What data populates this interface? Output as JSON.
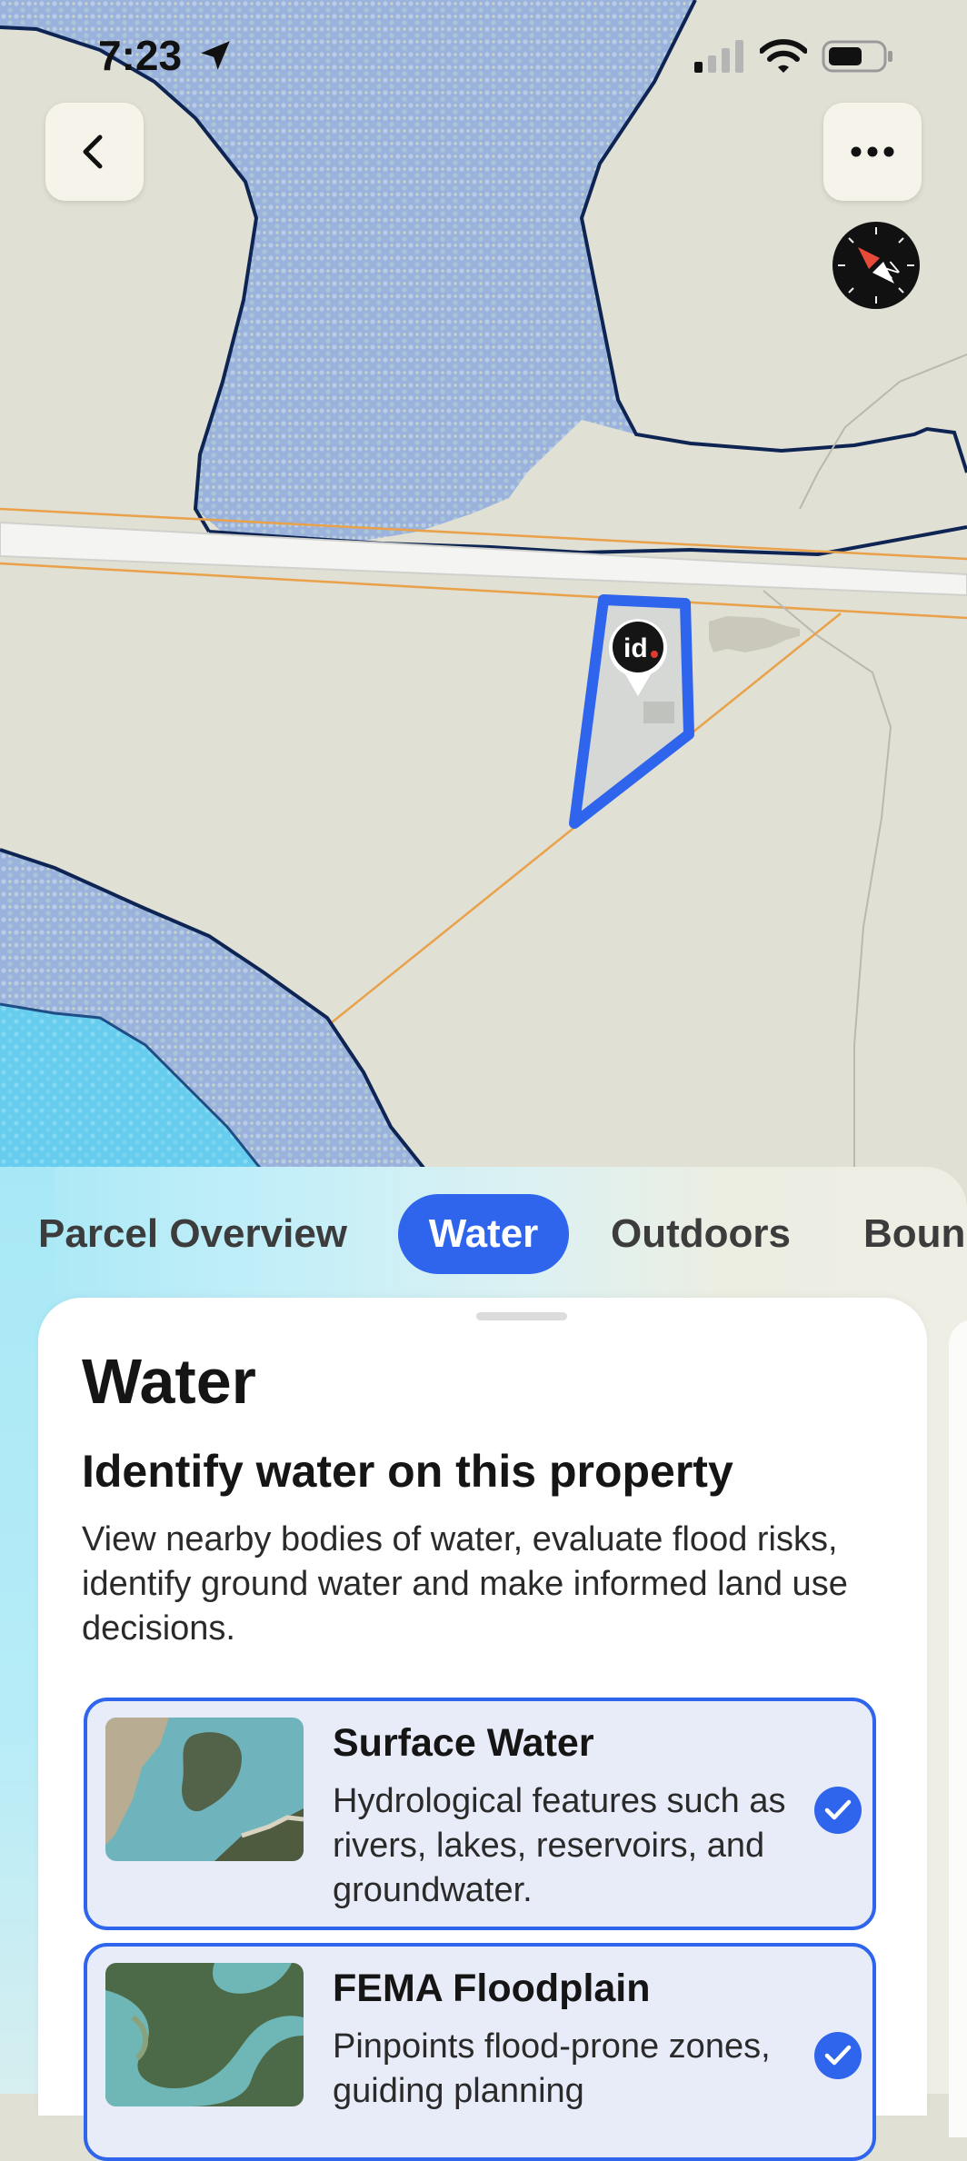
{
  "status_bar": {
    "time": "7:23",
    "location_icon": "location-arrow-icon",
    "signal_icon": "cellular-signal-icon",
    "wifi_icon": "wifi-icon",
    "battery_icon": "battery-icon"
  },
  "map": {
    "back_icon": "chevron-left-icon",
    "more_icon": "ellipsis-icon",
    "compass_icon": "compass-icon",
    "pin_label": "id",
    "colors": {
      "land": "#e1e0d4",
      "water_overlay": "#9db5dc",
      "floodplain": "#6fd3ef",
      "parcel_outline": "#2f64ec",
      "road": "#f2f2f0",
      "utility_line": "#e9a14a"
    }
  },
  "tabs": [
    {
      "label": "Parcel Overview",
      "active": false
    },
    {
      "label": "Water",
      "active": true
    },
    {
      "label": "Outdoors",
      "active": false
    },
    {
      "label": "Boun",
      "active": false
    }
  ],
  "card": {
    "title": "Water",
    "subtitle": "Identify water on this property",
    "description": "View nearby bodies of water, evaluate flood risks, identify ground water and make informed land use decisions.",
    "layers": [
      {
        "title": "Surface Water",
        "description": "Hydrological features such as rivers, lakes, reservoirs, and groundwater.",
        "checked": true,
        "thumb_icon": "surface-water-thumbnail"
      },
      {
        "title": "FEMA Floodplain",
        "description": "Pinpoints flood-prone zones, guiding planning",
        "checked": true,
        "thumb_icon": "floodplain-thumbnail"
      }
    ]
  },
  "accent_color": "#2f64ec"
}
